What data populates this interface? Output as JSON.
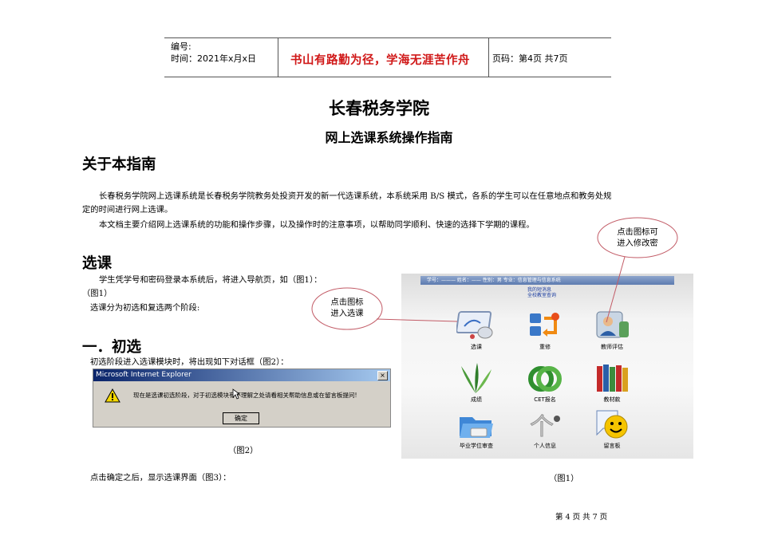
{
  "header": {
    "number_label": "编号:",
    "time_label": "时间：2021年x月x日",
    "motto": "书山有路勤为径，学海无涯苦作舟",
    "page_info": "页码：第4页  共7页"
  },
  "title": "长春税务学院",
  "subtitle": "网上选课系统操作指南",
  "sections": {
    "about_heading": "关于本指南",
    "about_p1_line1": "长春税务学院网上选课系统是长春税务学院教务处投资开发的新一代选课系统，本系统采用 B/S 模式，各系的学生可以在任意地点和教务处规",
    "about_p1_line2": "定的时间进行网上选课。",
    "about_p2": "本文档主要介绍网上选课系统的功能和操作步骤，以及操作时的注意事项，以帮助同学顺利、快速的选择下学期的课程。",
    "course_heading": "选课",
    "course_p1": "学生凭学号和密码登录本系统后，将进入导航页，如（图1）：",
    "course_p1_fig": "（图1）",
    "course_p2": "选课分为初选和复选两个阶段:",
    "stage1_heading": "一．初选",
    "stage1_p1": "初选阶段进入选课模块时，将出现如下对话框（图2）：",
    "fig2_caption": "（图2）",
    "after_confirm": "点击确定之后，显示选课界面（图3）：",
    "fig1_caption": "（图1）"
  },
  "dialog": {
    "title": "Microsoft Internet Explorer",
    "close": "×",
    "message": "现在是选课初选阶段，对于初选模块有不理解之处请看相关帮助信息或在留言板提问!",
    "ok_button": "确定"
  },
  "callouts": {
    "enter_course_line1": "点击图标",
    "enter_course_line2": "进入选课",
    "modify_line1": "点击图标可",
    "modify_line2": "进入修改密"
  },
  "nav_screen": {
    "top_bar": "学号：———   姓名：——   性别：男  专业：信息管理与信息系统",
    "links_line1": "我的短消息",
    "links_line2": "全校教室查询",
    "tiles": [
      {
        "label": "选课",
        "icon": "course-selection-icon"
      },
      {
        "label": "重修",
        "icon": "retake-icon"
      },
      {
        "label": "教师评估",
        "icon": "teacher-evaluation-icon"
      },
      {
        "label": "成绩",
        "icon": "grades-icon"
      },
      {
        "label": "CET报名",
        "icon": "cet-registration-icon"
      },
      {
        "label": "教材款",
        "icon": "textbook-fee-icon"
      },
      {
        "label": "毕业学位审查",
        "icon": "graduation-review-icon"
      },
      {
        "label": "个人信息",
        "icon": "personal-info-icon"
      },
      {
        "label": "留言板",
        "icon": "message-board-icon"
      }
    ]
  },
  "footer": "第 4 页 共 7 页"
}
